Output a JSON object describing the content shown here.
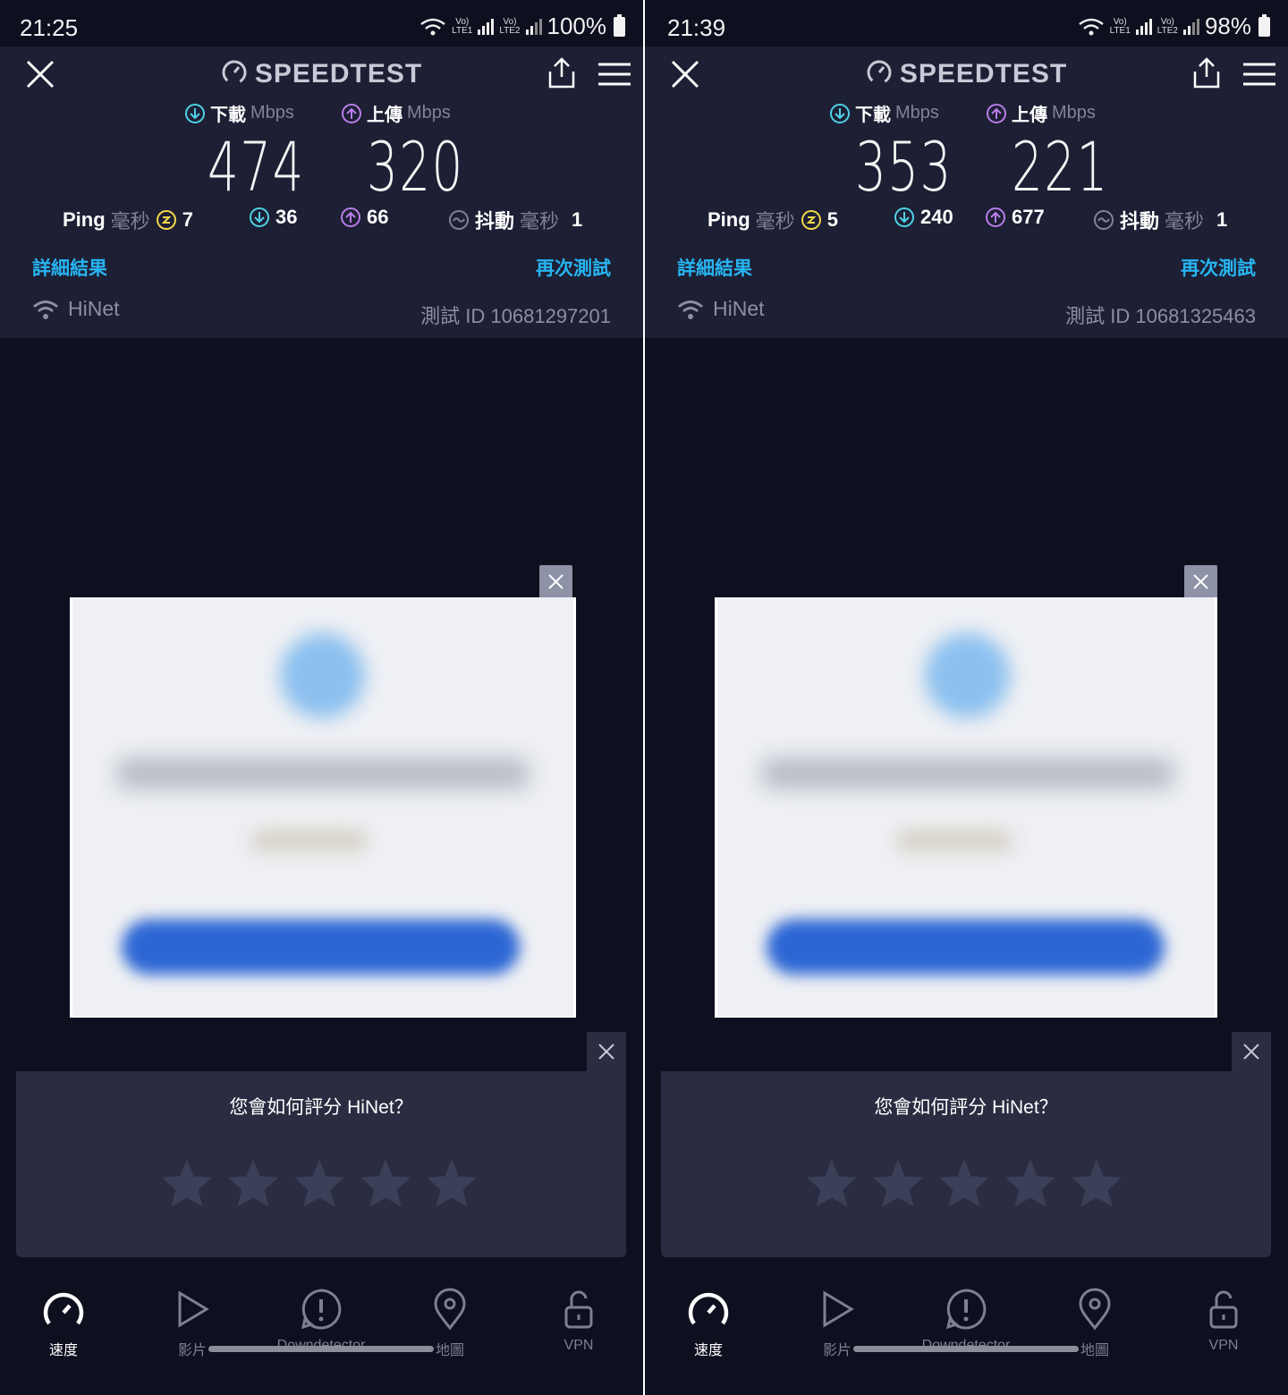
{
  "common": {
    "app_name": "SPEEDTEST",
    "download_label": "下載",
    "upload_label": "上傳",
    "unit_mbps": "Mbps",
    "ping_label": "Ping",
    "ms_label": "毫秒",
    "jitter_label": "抖動",
    "detailed_results": "詳細結果",
    "test_again": "再次測試",
    "isp_name": "HiNet",
    "test_id_label": "測試 ID",
    "rating_question": "您會如何評分 HiNet？",
    "rating_stars_total": 5,
    "rating_stars_selected": 0,
    "tabs": [
      {
        "label": "速度",
        "icon": "speedometer-icon",
        "active": true
      },
      {
        "label": "影片",
        "icon": "play-icon",
        "active": false
      },
      {
        "label": "Downdetector",
        "icon": "alert-icon",
        "active": false
      },
      {
        "label": "地圖",
        "icon": "map-pin-icon",
        "active": false
      },
      {
        "label": "VPN",
        "icon": "lock-icon",
        "active": false
      }
    ],
    "colors": {
      "background": "#0e0f1f",
      "panel": "#1d1f34",
      "download": "#4fd3e5",
      "upload": "#b97ee8",
      "ping": "#f3d84a",
      "link": "#27b5f2"
    }
  },
  "screens": [
    {
      "time": "21:25",
      "battery": "100%",
      "download": "474",
      "upload": "320",
      "ping": "7",
      "ping_down": "36",
      "ping_up": "66",
      "jitter": "1",
      "test_id": "10681297201"
    },
    {
      "time": "21:39",
      "battery": "98%",
      "download": "353",
      "upload": "221",
      "ping": "5",
      "ping_down": "240",
      "ping_up": "677",
      "jitter": "1",
      "test_id": "10681325463"
    }
  ]
}
